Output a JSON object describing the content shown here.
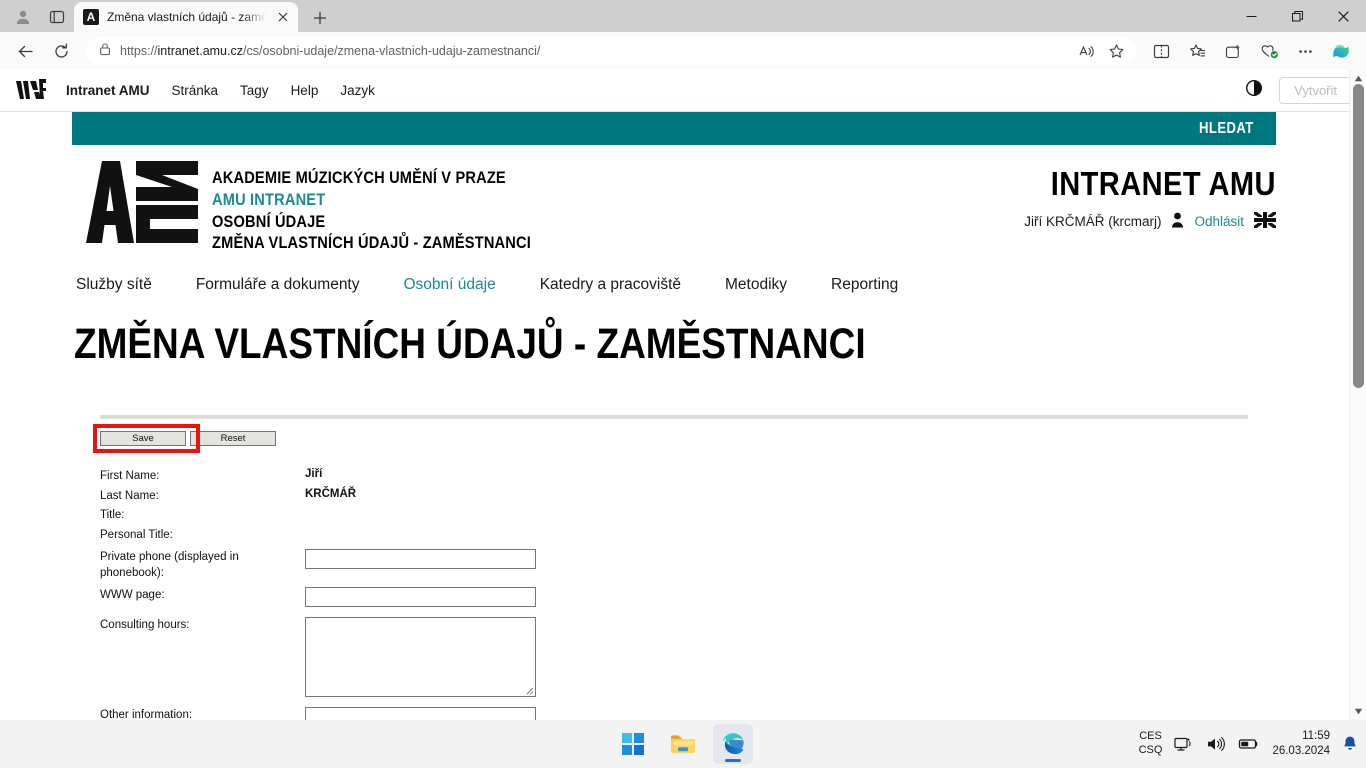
{
  "browser": {
    "tab": {
      "title": "Změna vlastních údajů - zaměstn",
      "favicon_letter": "A"
    },
    "url_prefix": "https://",
    "url_host": "intranet.amu.cz",
    "url_path": "/cs/osobni-udaje/zmena-vlastnich-udaju-zamestnanci/",
    "icons": {
      "profile": "profile-icon",
      "tab_search": "tab-search-icon",
      "new_tab": "new-tab-icon",
      "close_tab": "close-tab-icon",
      "back": "back-arrow-icon",
      "reload": "reload-icon",
      "site_info": "lock-icon",
      "read_aloud": "read-aloud-icon",
      "favorite": "star-icon",
      "split_screen": "split-screen-icon",
      "favorites_bar": "favorites-icon",
      "collections": "collections-icon",
      "browser_essentials": "browser-essentials-icon",
      "settings_more": "more-options-icon",
      "copilot": "copilot-icon",
      "minimize": "minimize-icon",
      "restore": "restore-icon",
      "close": "close-window-icon"
    }
  },
  "adminbar": {
    "logo": "wdf-logo",
    "items": [
      {
        "label": "Intranet AMU",
        "strong": true
      },
      {
        "label": "Stránka",
        "strong": false
      },
      {
        "label": "Tagy",
        "strong": false
      },
      {
        "label": "Help",
        "strong": false
      },
      {
        "label": "Jazyk",
        "strong": false
      }
    ],
    "contrast_icon": "contrast-toggle-icon",
    "create_label": "Vytvořit"
  },
  "searchbar": {
    "label": "HLEDAT",
    "color": "#00777f"
  },
  "brand": {
    "lines": [
      {
        "text": "AKADEMIE MÚZICKÝCH UMĚNÍ V PRAZE",
        "teal": false
      },
      {
        "text": "AMU INTRANET",
        "teal": true
      },
      {
        "text": "OSOBNÍ ÚDAJE",
        "teal": false
      },
      {
        "text": "ZMĚNA VLASTNÍCH ÚDAJŮ - ZAMĚSTNANCI",
        "teal": false
      }
    ],
    "logo_name": "amu-logo"
  },
  "header_right": {
    "title": "INTRANET AMU",
    "user": "Jiří KRČMÁŘ (krcmarj)",
    "logout": "Odhlásit",
    "user_icon": "user-icon",
    "flag_icon": "uk-flag-icon"
  },
  "mainnav": [
    {
      "label": "Služby sítě",
      "active": false
    },
    {
      "label": "Formuláře a dokumenty",
      "active": false
    },
    {
      "label": "Osobní údaje",
      "active": true
    },
    {
      "label": "Katedry a pracoviště",
      "active": false
    },
    {
      "label": "Metodiky",
      "active": false
    },
    {
      "label": "Reporting",
      "active": false
    }
  ],
  "page_title": "ZMĚNA VLASTNÍCH ÚDAJŮ - ZAMĚSTNANCI",
  "form": {
    "save_label": "Save",
    "reset_label": "Reset",
    "highlight_color": "#ee1111",
    "rows": [
      {
        "label": "First Name:",
        "type": "text",
        "value": "Jiří"
      },
      {
        "label": "Last Name:",
        "type": "text",
        "value": "KRČMÁŘ"
      },
      {
        "label": "Title:",
        "type": "text",
        "value": ""
      },
      {
        "label": "Personal Title:",
        "type": "text",
        "value": ""
      },
      {
        "label": "Private phone (displayed in phonebook):",
        "type": "input",
        "value": ""
      },
      {
        "label": "WWW page:",
        "type": "input",
        "value": ""
      },
      {
        "label": "Consulting hours:",
        "type": "textarea",
        "value": ""
      },
      {
        "label": "Other information:",
        "type": "input",
        "value": ""
      }
    ]
  },
  "taskbar": {
    "start": "windows-start-icon",
    "explorer": "file-explorer-icon",
    "edge": "edge-browser-icon",
    "keyboard_lang_top": "CES",
    "keyboard_lang_bottom": "CSQ",
    "network_icon": "network-icon",
    "volume_icon": "volume-icon",
    "battery_icon": "battery-icon",
    "notification_icon": "notification-bell-icon",
    "time": "11:59",
    "date": "26.03.2024"
  }
}
